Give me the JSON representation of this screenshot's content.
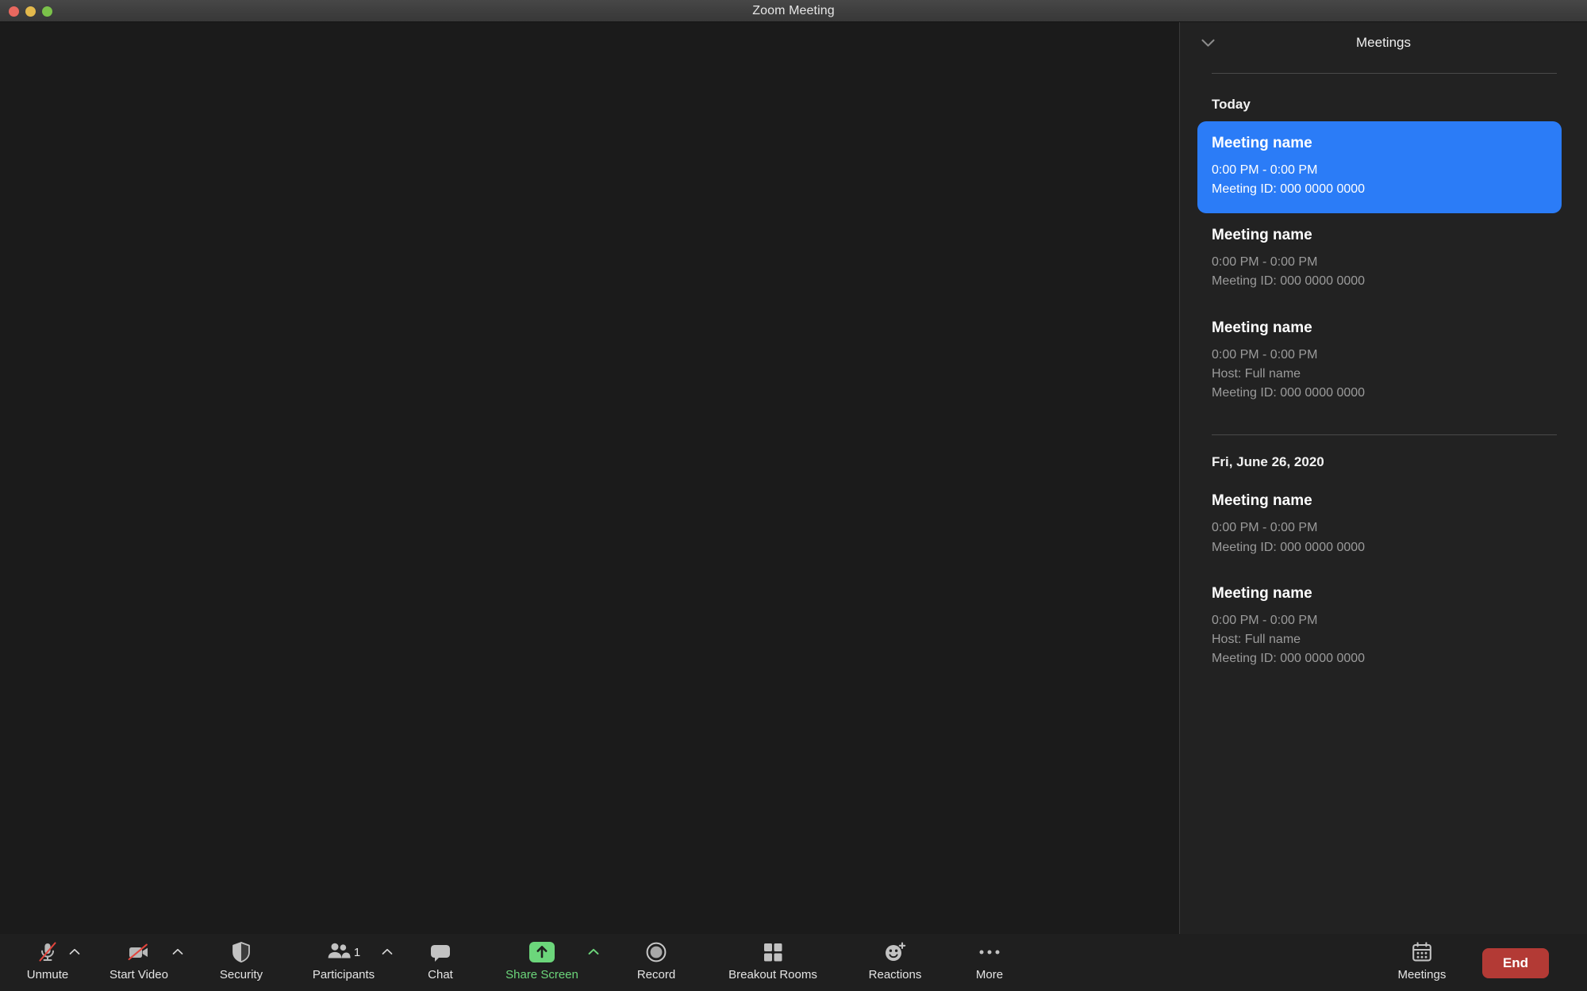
{
  "window": {
    "title": "Zoom Meeting",
    "traffic_lights": [
      {
        "name": "close",
        "color": "#e9685f"
      },
      {
        "name": "minimize",
        "color": "#e3b94c"
      },
      {
        "name": "maximize",
        "color": "#7bc24a"
      }
    ]
  },
  "sidebar": {
    "title": "Meetings",
    "collapse_icon": "chevron-down-icon",
    "groups": [
      {
        "label": "Today",
        "meetings": [
          {
            "name": "Meeting name",
            "time": "0:00 PM - 0:00 PM",
            "host": null,
            "meeting_id": "Meeting ID: 000 0000 0000",
            "selected": true
          },
          {
            "name": "Meeting name",
            "time": "0:00 PM - 0:00 PM",
            "host": null,
            "meeting_id": "Meeting ID: 000 0000 0000",
            "selected": false
          },
          {
            "name": "Meeting name",
            "time": "0:00 PM - 0:00 PM",
            "host": "Host: Full name",
            "meeting_id": "Meeting ID: 000 0000 0000",
            "selected": false
          }
        ]
      },
      {
        "label": "Fri, June 26, 2020",
        "meetings": [
          {
            "name": "Meeting name",
            "time": "0:00 PM - 0:00 PM",
            "host": null,
            "meeting_id": "Meeting ID: 000 0000 0000",
            "selected": false
          },
          {
            "name": "Meeting name",
            "time": "0:00 PM - 0:00 PM",
            "host": "Host: Full name",
            "meeting_id": "Meeting ID: 000 0000 0000",
            "selected": false
          }
        ]
      }
    ]
  },
  "toolbar": {
    "mute": {
      "label": "Unmute",
      "icon": "microphone-muted-icon",
      "has_caret": true
    },
    "video": {
      "label": "Start Video",
      "icon": "video-camera-off-icon",
      "has_caret": true
    },
    "security": {
      "label": "Security",
      "icon": "shield-icon",
      "has_caret": false
    },
    "participants": {
      "label": "Participants",
      "icon": "people-icon",
      "count": "1",
      "has_caret": true
    },
    "chat": {
      "label": "Chat",
      "icon": "speech-bubble-icon",
      "has_caret": false
    },
    "share": {
      "label": "Share Screen",
      "icon": "up-arrow-share-icon",
      "has_caret": true
    },
    "record": {
      "label": "Record",
      "icon": "record-circle-icon",
      "has_caret": false
    },
    "breakout": {
      "label": "Breakout Rooms",
      "icon": "grid-four-squares-icon",
      "has_caret": false
    },
    "reactions": {
      "label": "Reactions",
      "icon": "smiley-plus-icon",
      "has_caret": false
    },
    "more": {
      "label": "More",
      "icon": "ellipsis-icon",
      "has_caret": false
    },
    "meetings": {
      "label": "Meetings",
      "icon": "calendar-icon",
      "has_caret": false
    },
    "end": {
      "label": "End",
      "color": "#b33a35"
    }
  },
  "colors": {
    "accent_blue": "#2b7cf7",
    "accent_green": "#6cd67b",
    "danger_red": "#b33a35",
    "stage_bg": "#1b1b1b",
    "sidebar_bg": "#222222",
    "toolbar_bg": "#1f1f1f"
  }
}
